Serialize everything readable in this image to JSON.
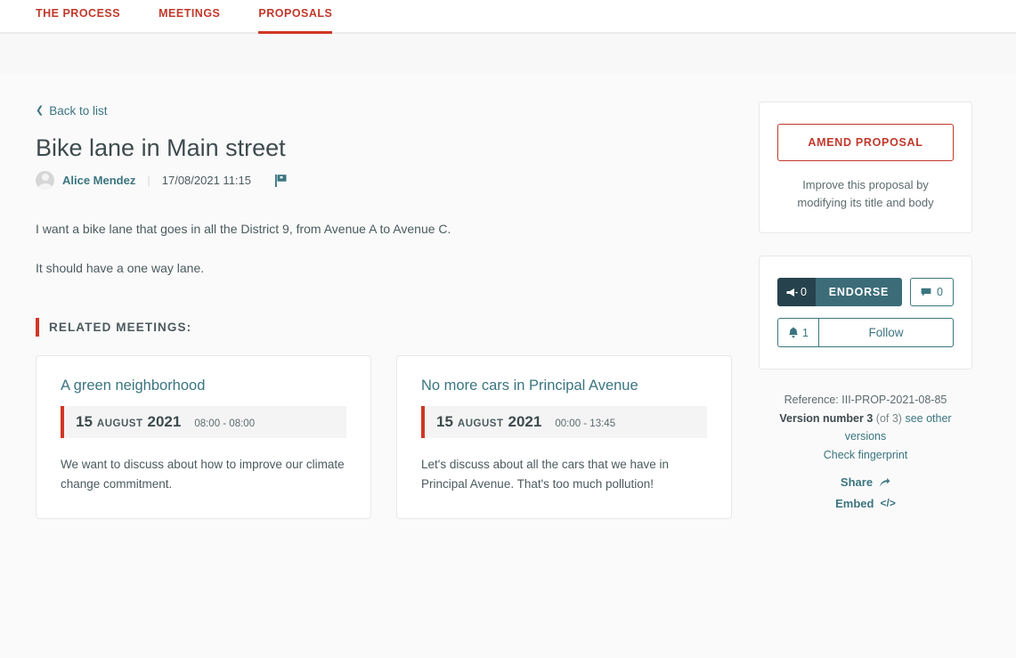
{
  "nav": {
    "items": [
      {
        "label": "THE PROCESS",
        "active": false
      },
      {
        "label": "MEETINGS",
        "active": false
      },
      {
        "label": "PROPOSALS",
        "active": true
      }
    ],
    "active_color": "#d03725"
  },
  "back_link": {
    "label": "Back to list"
  },
  "proposal": {
    "title": "Bike lane in Main street",
    "author": "Alice Mendez",
    "separator": "|",
    "timestamp": "17/08/2021 11:15",
    "body": [
      "I want a bike lane that goes in all the District 9, from Avenue A to Avenue C.",
      "It should have a one way lane."
    ]
  },
  "related": {
    "heading": "RELATED MEETINGS:",
    "meetings": [
      {
        "title": "A green neighborhood",
        "day": "15",
        "month": "AUGUST",
        "year": "2021",
        "time": "08:00 - 08:00",
        "body": "We want to discuss about how to improve our climate change commitment."
      },
      {
        "title": "No more cars in Principal Avenue",
        "day": "15",
        "month": "AUGUST",
        "year": "2021",
        "time": "00:00 - 13:45",
        "body": "Let's discuss about all the cars that we have in Principal Avenue. That's too much pollution!"
      }
    ]
  },
  "sidebar": {
    "amend": {
      "button_label": "AMEND PROPOSAL",
      "help_text": "Improve this proposal by modifying its title and body",
      "accent_color": "#c0392b"
    },
    "actions": {
      "endorsements_count": "0",
      "endorse_label": "ENDORSE",
      "comments_count": "0",
      "followers_count": "1",
      "follow_label": "Follow",
      "accent_color": "#3b7580"
    },
    "details": {
      "reference_label": "Reference:",
      "reference_value": "III-PROP-2021-08-85",
      "version_label": "Version number 3",
      "version_of": "(of 3)",
      "other_versions_link": "see other versions",
      "fingerprint_link": "Check fingerprint",
      "share_label": "Share",
      "embed_label": "Embed"
    }
  }
}
